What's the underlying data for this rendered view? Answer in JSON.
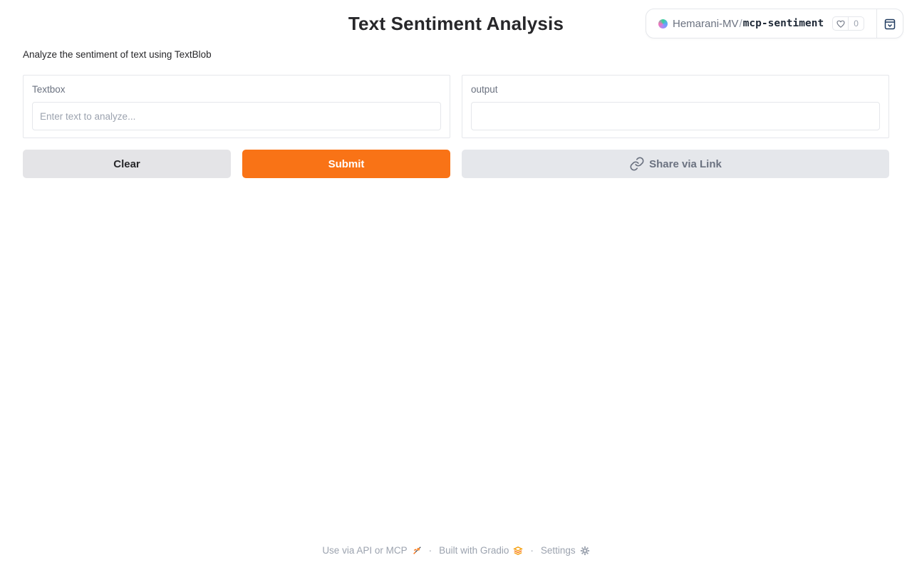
{
  "page": {
    "title": "Text Sentiment Analysis",
    "description": "Analyze the sentiment of text using TextBlob"
  },
  "space_badge": {
    "owner": "Hemarani-MV",
    "separator": "/",
    "repo": "mcp-sentiment",
    "likes": "0"
  },
  "input_panel": {
    "label": "Textbox",
    "placeholder": "Enter text to analyze...",
    "value": ""
  },
  "output_panel": {
    "label": "output",
    "value": ""
  },
  "buttons": {
    "clear": "Clear",
    "submit": "Submit",
    "share": "Share via Link"
  },
  "footer": {
    "api": "Use via API or MCP",
    "built": "Built with Gradio",
    "settings": "Settings",
    "separator": "·"
  },
  "colors": {
    "accent": "#f97316",
    "secondary_button": "#e4e4e7"
  }
}
